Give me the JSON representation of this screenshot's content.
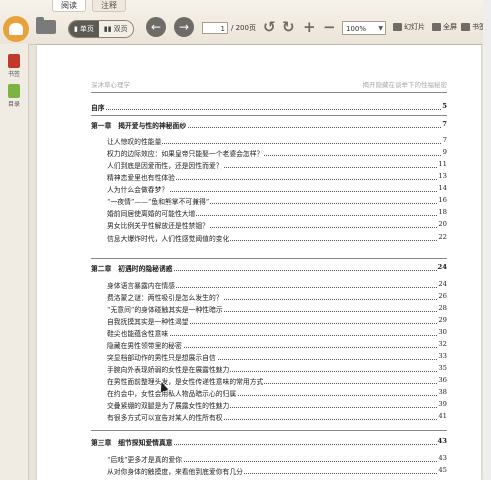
{
  "tabs": [
    "阅读",
    "注释"
  ],
  "toolbar": {
    "single_page": "单页",
    "double_page": "双页",
    "current_page": "1",
    "total_pages": "/ 200页",
    "zoom": "100%",
    "slideshow": "幻灯片",
    "fullscreen": "全屏",
    "bookmark": "书签"
  },
  "sidebar": {
    "items": [
      {
        "label": "书签",
        "icon": "bookmark-icon",
        "color": "#c0392b"
      },
      {
        "label": "目录",
        "icon": "toc-icon",
        "color": "#7cb342"
      }
    ]
  },
  "page": {
    "header_left": "深沐草心理学",
    "header_right": "揭开隐藏在谈举下的性福秘密",
    "preface": {
      "title": "自序",
      "page": "5"
    },
    "chapters": [
      {
        "title": "第一章　揭开爱与性的神秘面纱",
        "page": "7",
        "items": [
          {
            "title": "让人惊叹的性能量",
            "page": "7"
          },
          {
            "title": "权力的边际效应：如果皇帝只能娶一个老婆会怎样？",
            "page": "9"
          },
          {
            "title": "人们到底是因爱而性，还是因性而爱？",
            "page": "11"
          },
          {
            "title": "精神恋爱里也有性体验",
            "page": "13"
          },
          {
            "title": "人为什么会做春梦？",
            "page": "14"
          },
          {
            "title": "“一夜情”——“鱼和熊掌不可兼得”",
            "page": "16"
          },
          {
            "title": "婚前同居使离婚的可能性大增",
            "page": "18"
          },
          {
            "title": "男女比例关乎性解放还是性禁锢？",
            "page": "20"
          },
          {
            "title": "信息大爆炸时代，人们性感觉阈值的变化",
            "page": "22"
          }
        ]
      },
      {
        "title": "第二章　初遇时的隐秘诱惑",
        "page": "24",
        "items": [
          {
            "title": "身体语言暴露内在情感",
            "page": "24"
          },
          {
            "title": "费洛蒙之谜：两性吸引是怎么发生的？",
            "page": "26"
          },
          {
            "title": "“无意间”的身体碰触其实是一种性暗示",
            "page": "28"
          },
          {
            "title": "自我抚摸其实是一种性渴望",
            "page": "29"
          },
          {
            "title": "鞋尖也能蕴含性意味",
            "page": "30"
          },
          {
            "title": "隐藏在男性领带里的秘密",
            "page": "32"
          },
          {
            "title": "突显档部动作的男性只是想展示自信",
            "page": "33"
          },
          {
            "title": "手腕向外表现娇弱的女性是在展露性魅力",
            "page": "35"
          },
          {
            "title": "在男性面前整理头发，是女性传递性意味的常用方式",
            "page": "36"
          },
          {
            "title": "在约会中，女性会用私人物品暗示心的归属",
            "page": "38"
          },
          {
            "title": "交叠紧绷的双腿是为了展露女性的性魅力",
            "page": "39"
          },
          {
            "title": "有很多方式可以宣告对某人的性所有权",
            "page": "41"
          }
        ]
      },
      {
        "title": "第三章　细节探知爱情真意",
        "page": "43",
        "items": [
          {
            "title": "“后戏”更多才是真的爱你",
            "page": "43"
          },
          {
            "title": "从对你身体的触摸度，来看他到底爱你有几分",
            "page": "45"
          }
        ]
      }
    ]
  }
}
